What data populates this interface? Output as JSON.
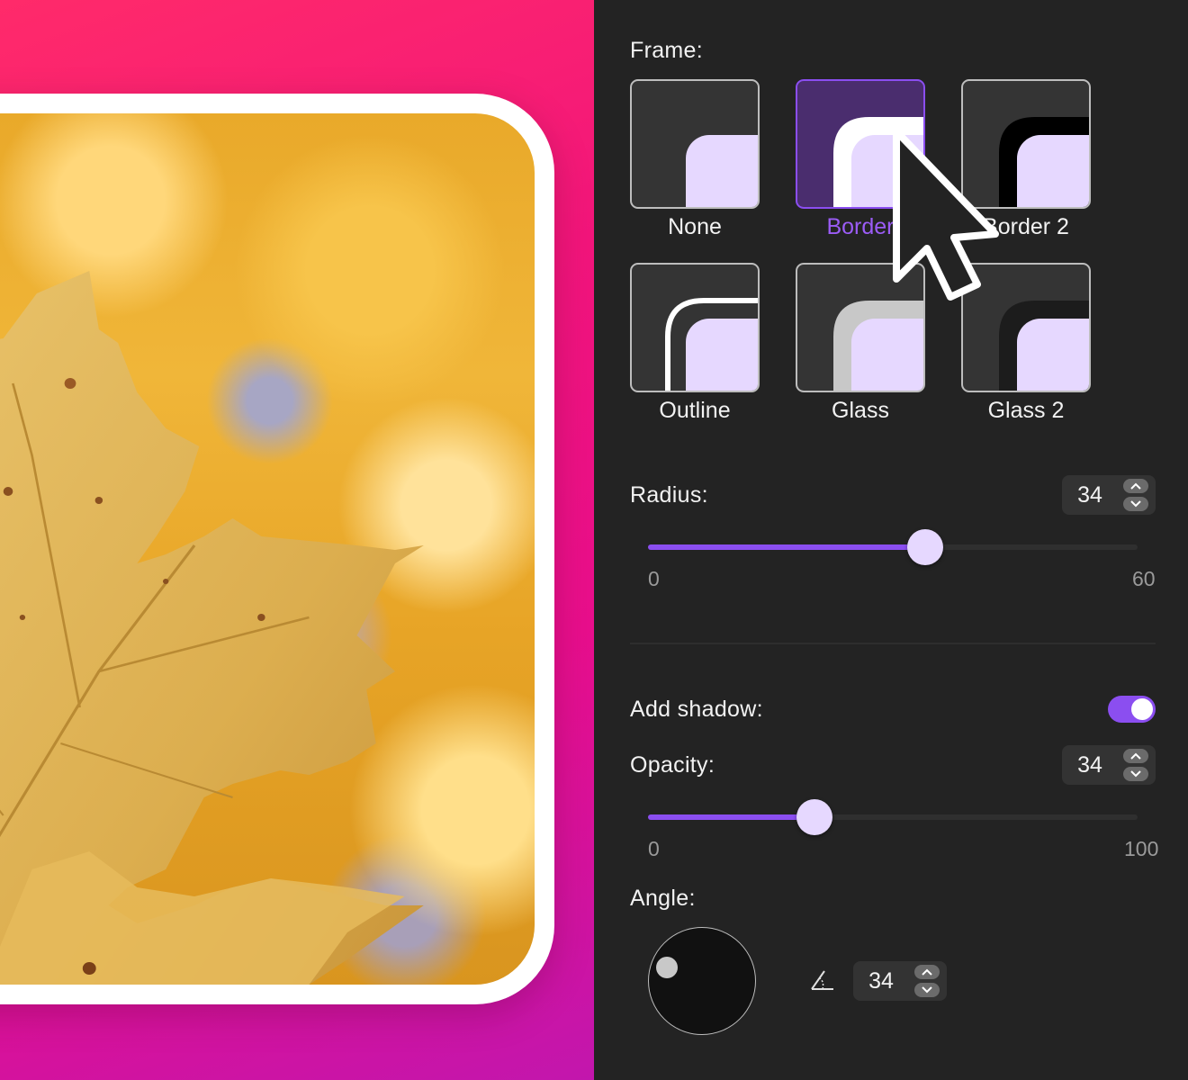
{
  "frame": {
    "label": "Frame:",
    "options": [
      {
        "label": "None",
        "style": "none"
      },
      {
        "label": "Border",
        "style": "border",
        "selected": true
      },
      {
        "label": "Border 2",
        "style": "border-dark"
      },
      {
        "label": "Outline",
        "style": "outline"
      },
      {
        "label": "Glass",
        "style": "glass"
      },
      {
        "label": "Glass 2",
        "style": "glass-dark"
      }
    ]
  },
  "radius": {
    "label": "Radius:",
    "value": "34",
    "min": "0",
    "max": "60"
  },
  "shadow": {
    "label": "Add shadow:",
    "enabled": true
  },
  "opacity": {
    "label": "Opacity:",
    "value": "34",
    "min": "0",
    "max": "100"
  },
  "angle": {
    "label": "Angle:",
    "value": "34",
    "icon": "angle-icon"
  },
  "colors": {
    "accent": "#8b4ef0",
    "thumb": "#e6d8ff",
    "panel": "#232323",
    "preview_gradient_start": "#ff2a6a",
    "preview_gradient_end": "#c216ad"
  }
}
